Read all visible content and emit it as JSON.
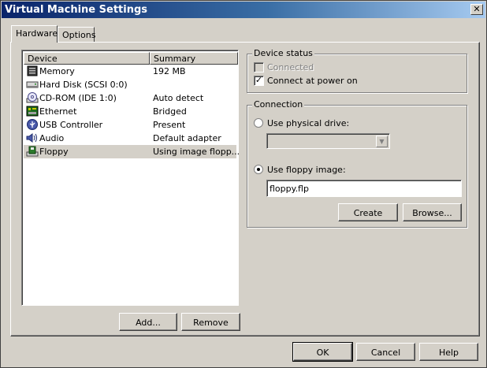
{
  "window": {
    "title": "Virtual Machine Settings",
    "close_glyph": "✕"
  },
  "tabs": [
    {
      "label": "Hardware",
      "active": true
    },
    {
      "label": "Options",
      "active": false
    }
  ],
  "device_list": {
    "columns": [
      "Device",
      "Summary"
    ],
    "rows": [
      {
        "name": "Memory",
        "summary": "192 MB",
        "icon": "memory-icon"
      },
      {
        "name": "Hard Disk (SCSI 0:0)",
        "summary": "",
        "icon": "hard-disk-icon"
      },
      {
        "name": "CD-ROM (IDE 1:0)",
        "summary": "Auto detect",
        "icon": "cdrom-icon"
      },
      {
        "name": "Ethernet",
        "summary": "Bridged",
        "icon": "ethernet-icon"
      },
      {
        "name": "USB Controller",
        "summary": "Present",
        "icon": "usb-icon"
      },
      {
        "name": "Audio",
        "summary": "Default adapter",
        "icon": "audio-icon"
      },
      {
        "name": "Floppy",
        "summary": "Using image flopp...",
        "icon": "floppy-icon",
        "selected": true
      }
    ]
  },
  "list_buttons": {
    "add": "Add...",
    "remove": "Remove"
  },
  "device_status": {
    "title": "Device status",
    "connected": {
      "label": "Connected",
      "checked": false,
      "enabled": false
    },
    "connect_at_power_on": {
      "label": "Connect at power on",
      "checked": true
    }
  },
  "connection": {
    "title": "Connection",
    "use_physical_drive": {
      "label": "Use physical drive:",
      "selected": false
    },
    "drive_select": {
      "value": ""
    },
    "use_floppy_image": {
      "label": "Use floppy image:",
      "selected": true
    },
    "floppy_image_path": {
      "value": "floppy.flp"
    },
    "create": "Create",
    "browse": "Browse..."
  },
  "footer": {
    "ok": "OK",
    "cancel": "Cancel",
    "help": "Help"
  }
}
